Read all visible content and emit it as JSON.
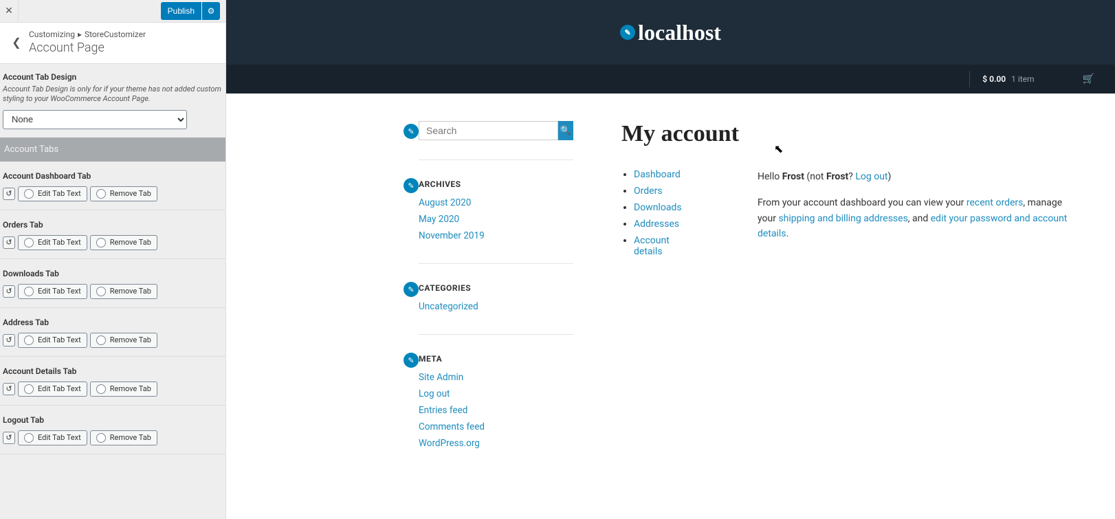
{
  "customizer": {
    "publish_label": "Publish",
    "crumb1": "Customizing",
    "crumb_sep": "▸",
    "crumb2": "StoreCustomizer",
    "page_title": "Account Page",
    "design": {
      "title": "Account Tab Design",
      "desc": "Account Tab Design is only for if your theme has not added custom styling to your WooCommerce Account Page.",
      "selected": "None"
    },
    "band": "Account Tabs",
    "edit_label": "Edit Tab Text",
    "remove_label": "Remove Tab",
    "tabs": [
      {
        "title": "Account Dashboard Tab"
      },
      {
        "title": "Orders Tab"
      },
      {
        "title": "Downloads Tab"
      },
      {
        "title": "Address Tab"
      },
      {
        "title": "Account Details Tab"
      },
      {
        "title": "Logout Tab"
      }
    ]
  },
  "preview": {
    "site_title": "localhost",
    "cart_price": "$ 0.00",
    "cart_items": "1 item",
    "search_placeholder": "Search",
    "archives": {
      "title": "ARCHIVES",
      "items": [
        "August 2020",
        "May 2020",
        "November 2019"
      ]
    },
    "categories": {
      "title": "CATEGORIES",
      "items": [
        "Uncategorized"
      ]
    },
    "meta": {
      "title": "META",
      "items": [
        "Site Admin",
        "Log out",
        "Entries feed",
        "Comments feed",
        "WordPress.org"
      ]
    },
    "page_heading": "My account",
    "acct_nav": [
      "Dashboard",
      "Orders",
      "Downloads",
      "Addresses",
      "Account details"
    ],
    "greeting": {
      "hello": "Hello ",
      "user": "Frost",
      "not": " (not ",
      "user2": "Frost",
      "q": "? ",
      "logout": "Log out",
      "close": ")"
    },
    "dash": {
      "p1a": "From your account dashboard you can view your ",
      "recent_orders": "recent orders",
      "p1b": ", manage your ",
      "shipping": "shipping and billing addresses",
      "p1c": ", and ",
      "edit_pw": "edit your password and account details",
      "p1d": "."
    }
  }
}
